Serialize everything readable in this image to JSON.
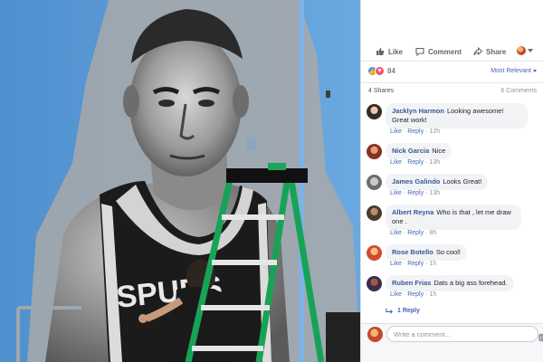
{
  "toolbar": {
    "like_label": "Like",
    "comment_label": "Comment",
    "share_label": "Share"
  },
  "reactions": {
    "count": "84",
    "icons": [
      "like-icon",
      "love-icon"
    ]
  },
  "sort": {
    "label": "Most Relevant"
  },
  "stats": {
    "shares": "4 Shares",
    "comments": "6 Comments"
  },
  "comments": [
    {
      "name": "Jacklyn Harmon",
      "text": "Looking awesome! Great work!",
      "like": "Like",
      "reply": "Reply",
      "time": "12h"
    },
    {
      "name": "Nick Garcia",
      "text": "Nice",
      "like": "Like",
      "reply": "Reply",
      "time": "13h"
    },
    {
      "name": "James Galindo",
      "text": "Looks Great!",
      "like": "Like",
      "reply": "Reply",
      "time": "13h"
    },
    {
      "name": "Albert Reyna",
      "text": "Who is that , let me draw one .",
      "like": "Like",
      "reply": "Reply",
      "time": "8h"
    },
    {
      "name": "Rose Botello",
      "text": "So cool!",
      "like": "Like",
      "reply": "Reply",
      "time": "1h"
    },
    {
      "name": "Ruben Frias",
      "text": "Dats a big ass forehead.",
      "like": "Like",
      "reply": "Reply",
      "time": "1h"
    }
  ],
  "reply_thread": {
    "label": "1 Reply"
  },
  "composer": {
    "placeholder": "Write a comment..."
  },
  "photo": {
    "jersey_text": "SPURS"
  },
  "colors": {
    "link": "#385898",
    "accent": "#4267b2",
    "wall": "#5b9ad6",
    "ladder": "#1aa55a"
  }
}
